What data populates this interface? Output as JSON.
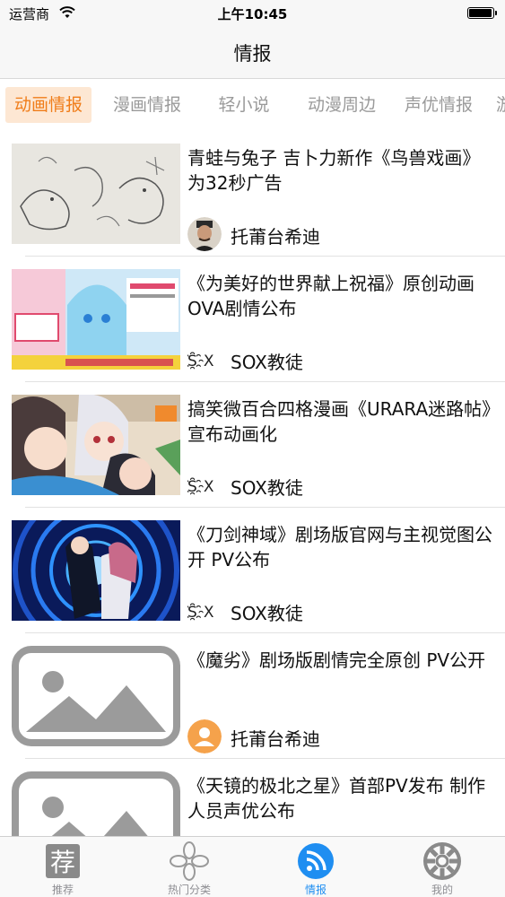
{
  "status_bar": {
    "carrier": "运营商",
    "time": "上午10:45"
  },
  "nav": {
    "title": "情报"
  },
  "tabs": [
    {
      "label": "动画情报",
      "active": true
    },
    {
      "label": "漫画情报",
      "active": false
    },
    {
      "label": "轻小说",
      "active": false
    },
    {
      "label": "动漫周边",
      "active": false
    },
    {
      "label": "声优情报",
      "active": false
    },
    {
      "label": "游",
      "active": false
    }
  ],
  "articles": [
    {
      "title": "青蛙与兔子 吉卜力新作《鸟兽戏画》为32秒广告",
      "author": "托莆台希迪",
      "thumb_icon": "ink-drawing-thumbnail",
      "avatar_icon": "user-photo-avatar"
    },
    {
      "title": "《为美好的世界献上祝福》原创动画OVA剧情公布",
      "author": "SOX教徒",
      "author_logo": "S҈X",
      "thumb_icon": "anime-poster-thumbnail",
      "avatar_icon": "sox-logo-icon"
    },
    {
      "title": "搞笑微百合四格漫画《URARA迷路帖》宣布动画化",
      "author": "SOX教徒",
      "author_logo": "S҈X",
      "thumb_icon": "anime-girls-thumbnail",
      "avatar_icon": "sox-logo-icon"
    },
    {
      "title": "《刀剑神域》剧场版官网与主视觉图公开 PV公布",
      "author": "SOX教徒",
      "author_logo": "S҈X",
      "thumb_icon": "anime-key-visual-thumbnail",
      "avatar_icon": "sox-logo-icon"
    },
    {
      "title": "《魔劣》剧场版剧情完全原创 PV公开",
      "author": "托莆台希迪",
      "thumb_icon": "image-placeholder-icon",
      "avatar_icon": "default-user-avatar"
    },
    {
      "title": "《天镜的极北之星》首部PV发布 制作人员声优公布",
      "author": "",
      "thumb_icon": "image-placeholder-icon",
      "avatar_icon": ""
    }
  ],
  "tab_bar": [
    {
      "label": "推荐",
      "glyph": "荐",
      "icon": "recommend-icon",
      "active": false
    },
    {
      "label": "热门分类",
      "icon": "clover-icon",
      "active": false
    },
    {
      "label": "情报",
      "icon": "rss-feed-icon",
      "active": true
    },
    {
      "label": "我的",
      "icon": "wheel-icon",
      "active": false
    }
  ],
  "colors": {
    "accent": "#f07d1a",
    "active_tab_bg": "#fde7d3",
    "tabbar_active": "#1f8ef1",
    "inactive_text": "#9a9a9a",
    "placeholder_gray": "#9b9b9b"
  }
}
